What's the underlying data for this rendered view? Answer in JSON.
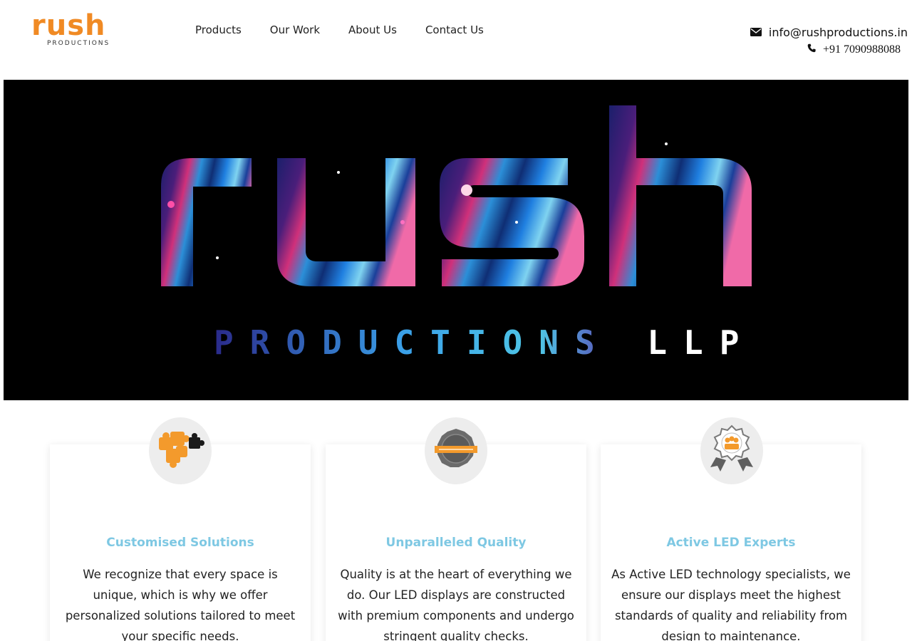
{
  "header": {
    "logo": {
      "word": "rush",
      "sub": "PRODUCTIONS"
    },
    "nav": [
      {
        "label": "Products"
      },
      {
        "label": "Our Work"
      },
      {
        "label": "About Us"
      },
      {
        "label": "Contact Us"
      }
    ],
    "contact": {
      "email": "info@rushproductions.in",
      "phone": "+91 7090988088",
      "email_icon": "envelope-icon",
      "phone_icon": "phone-icon"
    }
  },
  "hero": {
    "word": "rush",
    "subtitle": "PRODUCTIONS LLP"
  },
  "features": [
    {
      "icon": "puzzle-icon",
      "title": "Customised Solutions",
      "text": "We recognize that every space is unique, which is why we offer personalized solutions tailored to meet your specific needs."
    },
    {
      "icon": "quality-seal-icon",
      "title": "Unparalleled Quality",
      "text": "Quality is at the heart of everything we do. Our LED displays are constructed with premium components and undergo stringent quality checks."
    },
    {
      "icon": "expert-badge-icon",
      "title": "Active LED Experts",
      "text": "As Active LED technology specialists, we ensure our displays meet the highest standards of quality and reliability from design to maintenance."
    }
  ],
  "colors": {
    "brand_orange": "#f08a24",
    "title_blue": "#7ec8e3",
    "hero_bg": "#000000"
  }
}
